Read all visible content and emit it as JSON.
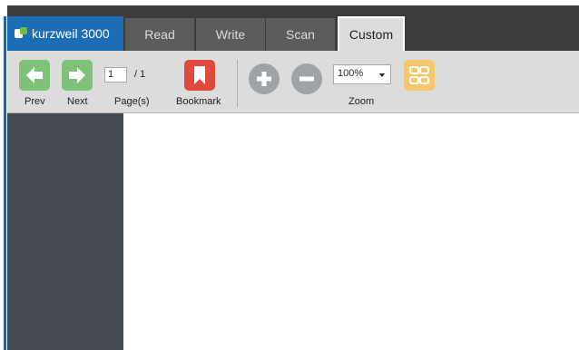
{
  "brand": {
    "name": "kurzweil 3000"
  },
  "tabs": [
    {
      "label": "Read"
    },
    {
      "label": "Write"
    },
    {
      "label": "Scan"
    },
    {
      "label": "Custom",
      "selected": true
    }
  ],
  "ribbon": {
    "prev_label": "Prev",
    "next_label": "Next",
    "page_value": "1",
    "page_total": "/ 1",
    "pages_label": "Page(s)",
    "bookmark_label": "Bookmark",
    "zoom_value": "100%",
    "zoom_label": "Zoom"
  },
  "icons": {
    "prev": "arrow-left-icon",
    "next": "arrow-right-icon",
    "bookmark": "bookmark-icon",
    "zoom_in": "plus-icon",
    "zoom_out": "minus-icon",
    "layout": "grid-icon"
  },
  "colors": {
    "brand": "#1d6db4",
    "nav_button": "#7ec27a",
    "bookmark": "#e04a3a",
    "zoom_button": "#9ea3a8",
    "layout_button": "#f6c76c",
    "sidepanel": "#444a50"
  }
}
